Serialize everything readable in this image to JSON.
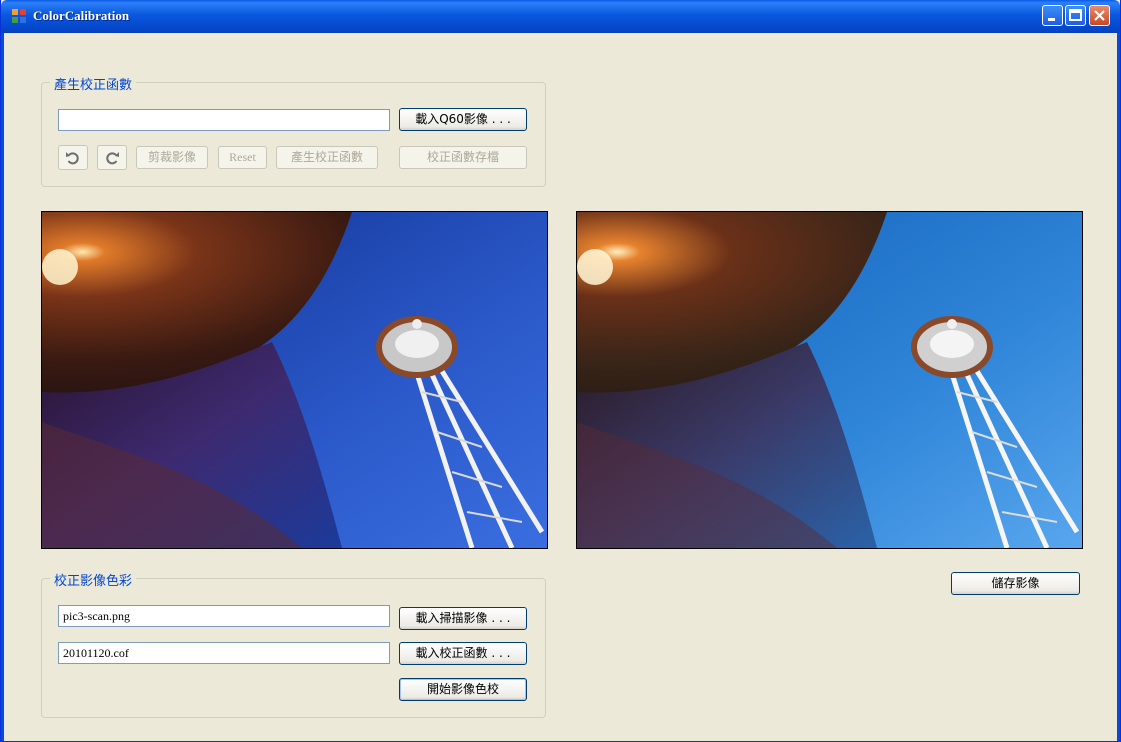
{
  "window": {
    "title": "ColorCalibration",
    "icon": "app-icon"
  },
  "generate_group": {
    "title": "產生校正函數",
    "path_value": "",
    "load_q60_label": "載入Q60影像 . . .",
    "crop_label": "剪裁影像",
    "reset_label": "Reset",
    "generate_label": "產生校正函數",
    "save_function_label": "校正函數存檔",
    "rotate_left_icon": "rotate-ccw-icon",
    "rotate_right_icon": "rotate-cw-icon"
  },
  "calibrate_group": {
    "title": "校正影像色彩",
    "scan_file_value": "pic3-scan.png",
    "load_scan_label": "載入掃描影像 . . .",
    "cof_file_value": "20101120.cof",
    "load_cof_label": "載入校正函數 . . .",
    "start_label": "開始影像色校"
  },
  "save_image_label": "儲存影像",
  "colors": {
    "titlebar": "#0a58e0",
    "window_bg": "#ece9d8",
    "group_title": "#0046d5",
    "sky": "#1d4fc4"
  }
}
